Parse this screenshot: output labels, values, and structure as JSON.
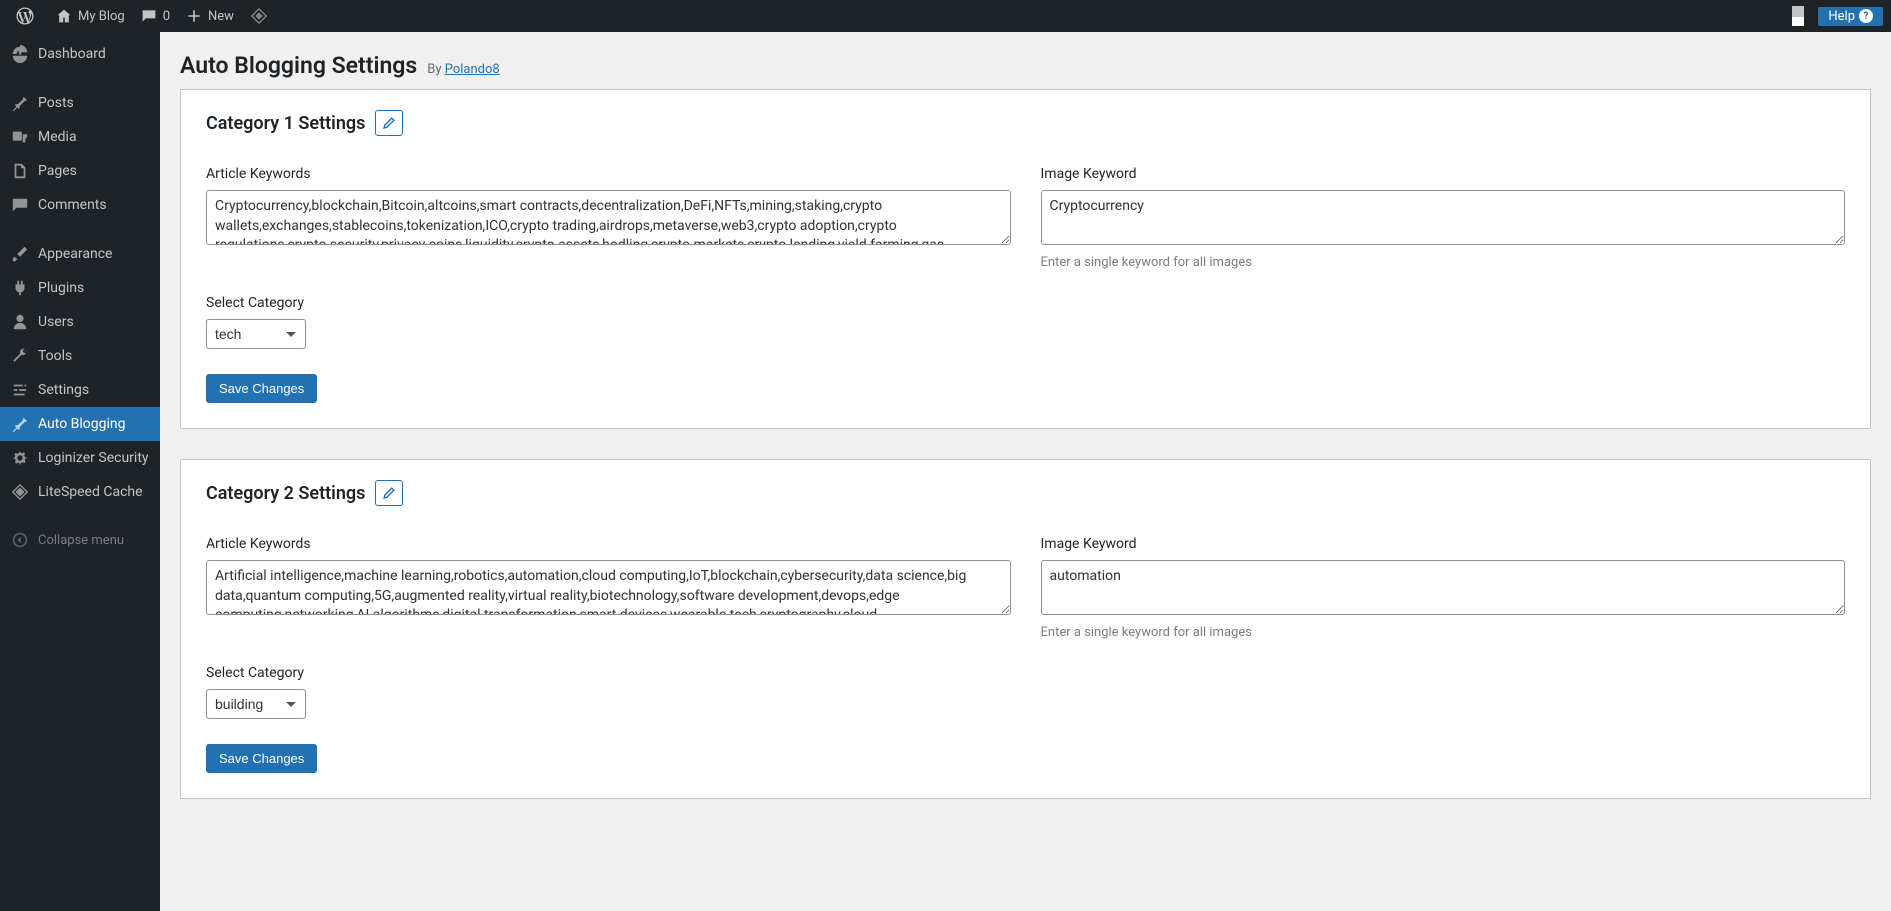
{
  "adminbar": {
    "site_name": "My Blog",
    "comments_count": "0",
    "new_label": "New",
    "help_label": "Help"
  },
  "sidebar": {
    "items": [
      {
        "label": "Dashboard",
        "icon": "dashboard"
      },
      {
        "label": "Posts",
        "icon": "pin"
      },
      {
        "label": "Media",
        "icon": "media"
      },
      {
        "label": "Pages",
        "icon": "pages"
      },
      {
        "label": "Comments",
        "icon": "comment"
      },
      {
        "label": "Appearance",
        "icon": "brush"
      },
      {
        "label": "Plugins",
        "icon": "plug"
      },
      {
        "label": "Users",
        "icon": "user"
      },
      {
        "label": "Tools",
        "icon": "wrench"
      },
      {
        "label": "Settings",
        "icon": "sliders"
      },
      {
        "label": "Auto Blogging",
        "icon": "pin"
      },
      {
        "label": "Loginizer Security",
        "icon": "gear"
      },
      {
        "label": "LiteSpeed Cache",
        "icon": "diamond"
      }
    ],
    "collapse_label": "Collapse menu"
  },
  "page": {
    "title": "Auto Blogging Settings",
    "by": "By",
    "author": "Polando8"
  },
  "category1": {
    "heading": "Category 1 Settings",
    "article_keywords_label": "Article Keywords",
    "article_keywords_value": "Cryptocurrency,blockchain,Bitcoin,altcoins,smart contracts,decentralization,DeFi,NFTs,mining,staking,crypto wallets,exchanges,stablecoins,tokenization,ICO,crypto trading,airdrops,metaverse,web3,crypto adoption,crypto regulations,crypto security,privacy coins,liquidity,crypto assets,hodling,crypto markets,crypto lending,yield farming,gas fees,hash",
    "image_keyword_label": "Image Keyword",
    "image_keyword_value": "Cryptocurrency",
    "image_keyword_help": "Enter a single keyword for all images",
    "select_category_label": "Select Category",
    "selected_category": "tech",
    "save_label": "Save Changes"
  },
  "category2": {
    "heading": "Category 2 Settings",
    "article_keywords_label": "Article Keywords",
    "article_keywords_value": "Artificial intelligence,machine learning,robotics,automation,cloud computing,IoT,blockchain,cybersecurity,data science,big data,quantum computing,5G,augmented reality,virtual reality,biotechnology,software development,devops,edge computing,networking,AI algorithms,digital transformation,smart devices,wearable tech,cryptography,cloud",
    "image_keyword_label": "Image Keyword",
    "image_keyword_value": "automation",
    "image_keyword_help": "Enter a single keyword for all images",
    "select_category_label": "Select Category",
    "selected_category": "building",
    "save_label": "Save Changes"
  }
}
